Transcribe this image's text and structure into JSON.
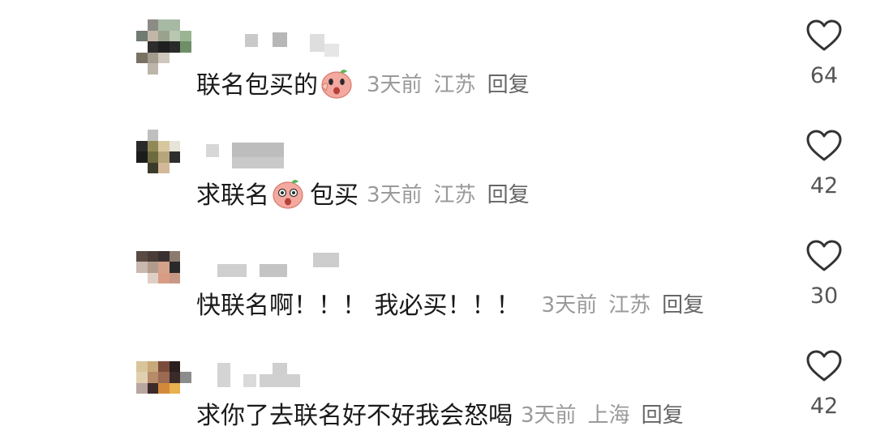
{
  "colors": {
    "text_primary": "#1a1a1a",
    "text_meta": "#9a9a9a",
    "text_reply": "#666666",
    "heart_outline": "#333333",
    "emoji_peach": "#f2a9a0"
  },
  "comments": [
    {
      "content_before": "联名包买的",
      "emoji": "peach-emoji",
      "content_after": "",
      "time": "3天前",
      "location": "江苏",
      "reply_label": "回复",
      "likes": "64"
    },
    {
      "content_before": "求联名",
      "emoji": "peach-emoji",
      "content_after": "包买",
      "time": "3天前",
      "location": "江苏",
      "reply_label": "回复",
      "likes": "42"
    },
    {
      "content_before": "快联名啊！！！ 我必买！！！",
      "emoji": "",
      "content_after": "",
      "time": "3天前",
      "location": "江苏",
      "reply_label": "回复",
      "likes": "30"
    },
    {
      "content_before": "求你了去联名好不好我会怒喝",
      "emoji": "",
      "content_after": "",
      "time": "3天前",
      "location": "上海",
      "reply_label": "回复",
      "likes": "42"
    }
  ]
}
